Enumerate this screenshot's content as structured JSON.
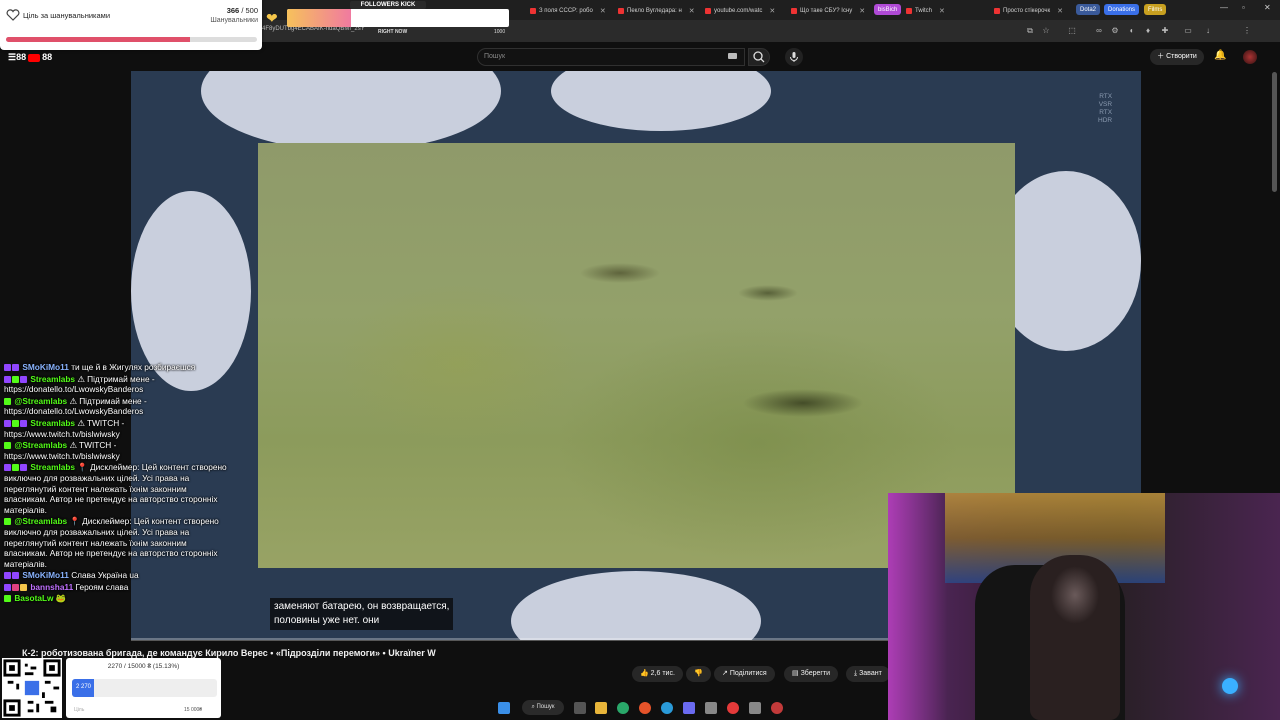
{
  "browser": {
    "tabs": [
      {
        "label": "З поля СССР: робо"
      },
      {
        "label": "Пекло Вугледара: н"
      },
      {
        "label": "youtube.com/watc"
      },
      {
        "label": "Що таке СБУ? Існу"
      },
      {
        "label": "Twitch"
      },
      {
        "label": "Просто стікерочк"
      }
    ],
    "chips": [
      {
        "label": "bisBich",
        "color": "#b04ad6"
      },
      {
        "label": "Dota2",
        "color": "#3a5a9a"
      },
      {
        "label": "Donations",
        "color": "#3a6fe8"
      },
      {
        "label": "Films",
        "color": "#c8a020"
      }
    ],
    "url": "4F8yDUTbg4ECABAIK-ndaQBMf_2sY"
  },
  "goal_widget": {
    "label": "Ціль за шанувальниками",
    "current": "366",
    "total": "/ 500",
    "sub": "Шанувальники",
    "progress": 0.732,
    "accent": "#e0506a"
  },
  "kick_widget": {
    "title": "FOLLOWERS KICK",
    "value": "289 (28%)",
    "right_now": "RIGHT NOW",
    "max": "1000",
    "progress": 0.289
  },
  "youtube": {
    "logo_text_left": "88",
    "logo_text_right": "88",
    "search_placeholder": "Пошук",
    "create_label": "Створити"
  },
  "video": {
    "watermark": [
      "RTX",
      "VSR",
      "RTX",
      "HDR"
    ],
    "subtitle": "заменяют батарею, он возвращается,\nполовины уже нет. они",
    "title": "К-2: роботизована бригада, де командує Кирило Верес • «Підрозділи перемоги» • Ukraïner W",
    "actions": {
      "likes": "2,6 тис.",
      "share": "Поділитися",
      "save": "Зберегти",
      "download": "Завант"
    }
  },
  "chat": [
    {
      "nick": "SMoKiMo11",
      "color": "#8ab4ff",
      "text": "ти ще й в Жигулях розбираєшся",
      "badges": [
        "#9146ff",
        "#9146ff"
      ]
    },
    {
      "nick": "Streamlabs",
      "color": "#53fc18",
      "text": "⚠ Підтримай мене - https://donatello.to/LwowskyBanderos",
      "badges": [
        "#9146ff",
        "#53fc18",
        "#9146ff"
      ]
    },
    {
      "nick": "@Streamlabs",
      "color": "#53fc18",
      "text": "⚠ Підтримай мене - https://donatello.to/LwowskyBanderos",
      "badges": [
        "#53fc18"
      ]
    },
    {
      "nick": "Streamlabs",
      "color": "#53fc18",
      "text": "⚠ TWITCH - https://www.twitch.tv/bislwiwsky",
      "badges": [
        "#9146ff",
        "#53fc18",
        "#9146ff"
      ]
    },
    {
      "nick": "@Streamlabs",
      "color": "#53fc18",
      "text": "⚠ TWITCH - https://www.twitch.tv/bislwiwsky",
      "badges": [
        "#53fc18"
      ]
    },
    {
      "nick": "Streamlabs",
      "color": "#53fc18",
      "text": "📍 Дисклеймер: Цей контент створено виключно для розважальних цілей. Усі права на переглянутий контент належать їхнім законним власникам. Автор не претендує на авторство сторонніх матеріалів.",
      "badges": [
        "#9146ff",
        "#53fc18",
        "#9146ff"
      ]
    },
    {
      "nick": "@Streamlabs",
      "color": "#53fc18",
      "text": "📍 Дисклеймер: Цей контент створено виключно для розважальних цілей. Усі права на переглянутий контент належать їхнім законним власникам. Автор не претендує на авторство сторонніх матеріалів.",
      "badges": [
        "#53fc18"
      ]
    },
    {
      "nick": "SMoKiMo11",
      "color": "#8ab4ff",
      "text": "Слава Україна ua",
      "badges": [
        "#9146ff",
        "#9146ff"
      ]
    },
    {
      "nick": "bannsha11",
      "color": "#c070ff",
      "text": "Героям слава",
      "badges": [
        "#9146ff",
        "#e04080",
        "#f5c64a"
      ]
    },
    {
      "nick": "BasotaLw",
      "color": "#53fc18",
      "text": "🐸",
      "badges": [
        "#53fc18"
      ]
    }
  ],
  "donation": {
    "text": "2270 / 15000 ₴ (15.13%)",
    "bar_value": "2 270",
    "left": "Ціль",
    "right": "15 000₴",
    "progress": 0.1513,
    "accent": "#3a6fe8"
  },
  "taskbar": {
    "search": "Пошук"
  }
}
